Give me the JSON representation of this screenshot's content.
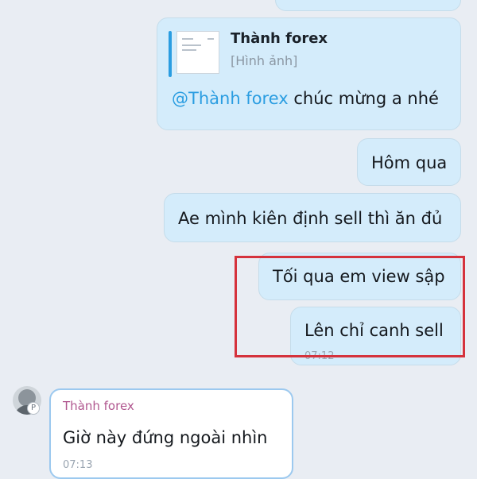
{
  "messages": [
    {
      "id": "quoted",
      "quote": {
        "name": "Thành forex",
        "type": "[Hình ảnh]"
      },
      "mention": "@Thành forex",
      "text": " chúc mừng a nhé"
    },
    {
      "id": "m2",
      "text": "Hôm qua"
    },
    {
      "id": "m3",
      "text": "Ae mình kiên định sell thì ăn đủ"
    },
    {
      "id": "m4",
      "text": "Tối qua em view sập"
    },
    {
      "id": "m5",
      "text": "Lên chỉ canh sell",
      "time": "07:12"
    },
    {
      "id": "m6",
      "sender": "Thành forex",
      "text": "Giờ này đứng ngoài nhìn",
      "time": "07:13"
    }
  ],
  "colors": {
    "background": "#e9edf3",
    "outgoing_bubble": "#d4ecfb",
    "incoming_bubble": "#ffffff",
    "mention": "#2a9de1",
    "sender_name": "#b0578f",
    "highlight_box": "#d5323c"
  },
  "icons": {
    "avatar": "user-avatar",
    "avatar_badge": "p-badge-icon"
  }
}
